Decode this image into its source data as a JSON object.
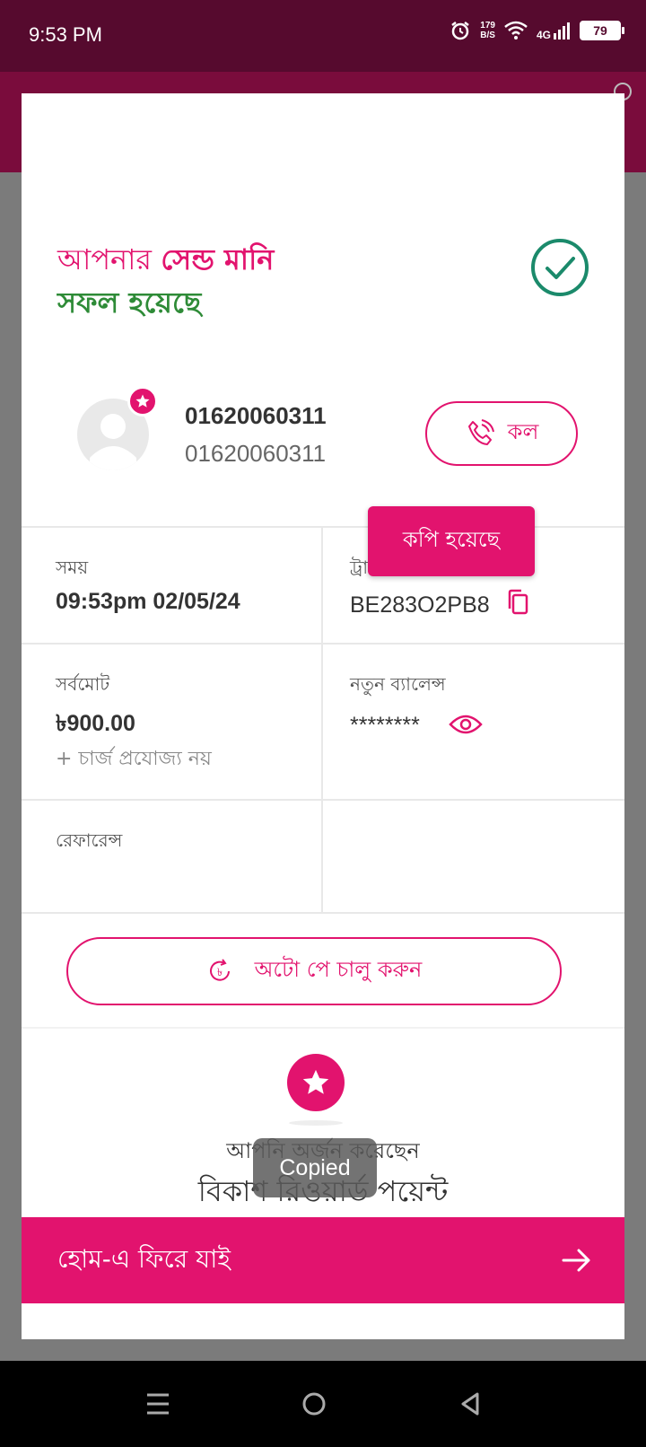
{
  "status_bar": {
    "time": "9:53 PM",
    "net_speed_value": "179",
    "net_speed_unit": "B/S",
    "network": "4G",
    "battery": "79"
  },
  "result": {
    "title_prefix": "আপনার",
    "title_highlight": "সেন্ড মানি",
    "title_status": "সফল হয়েছে"
  },
  "recipient": {
    "name": "01620060311",
    "number": "01620060311",
    "call_label": "কল"
  },
  "tooltip": {
    "text": "কপি হয়েছে"
  },
  "details": {
    "time_label": "সময়",
    "time_value": "09:53pm 02/05/24",
    "trx_label": "ট্রানজেকশন আইডি",
    "trx_value": "BE283O2PB8",
    "total_label": "সর্বমোট",
    "total_value": "৳900.00",
    "charge_note": "+ চার্জ প্রযোজ্য নয়",
    "balance_label": "নতুন ব্যালেন্স",
    "balance_value": "********",
    "reference_label": "রেফারেন্স"
  },
  "autopay": {
    "label": "অটো পে চালু করুন"
  },
  "rewards": {
    "caption": "আপনি অর্জন করেছেন",
    "title": "বিকাশ রিওয়ার্ড পয়েন্ট"
  },
  "toast": {
    "text": "Copied"
  },
  "footer": {
    "home_label": "হোম-এ ফিরে যাই"
  },
  "colors": {
    "brand": "#e2136e",
    "success": "#2e8b37",
    "status_bar": "#560a2e"
  }
}
